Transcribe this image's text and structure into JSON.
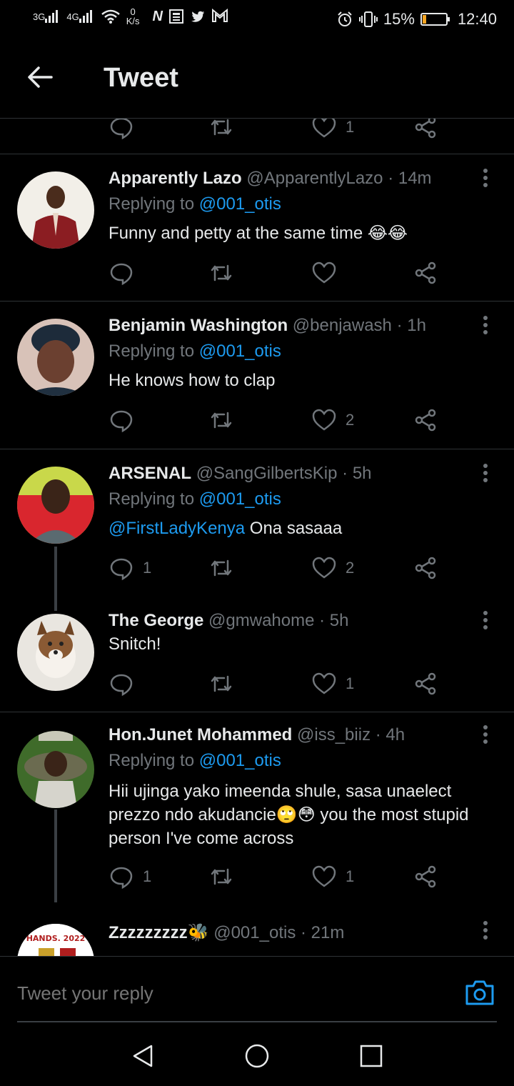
{
  "status_bar": {
    "net1": "3G",
    "net2": "4G",
    "speed_value": "0",
    "speed_unit": "K/s",
    "battery_percent": "15%",
    "battery_level": 0.15,
    "time": "12:40",
    "app_icons": [
      "N",
      "news-icon",
      "twitter-icon",
      "gmail-icon"
    ]
  },
  "header": {
    "title": "Tweet"
  },
  "partial_tweet": {
    "like_count": "1"
  },
  "tweets": [
    {
      "name": "Apparently Lazo",
      "handle": "@ApparentlyLazo",
      "time": "· 14m",
      "replying_prefix": "Replying to",
      "replying_to": "@001_otis",
      "text": "Funny and petty at the same time 😂😂",
      "reply_count": "",
      "like_count": ""
    },
    {
      "name": "Benjamin Washington",
      "handle": "@benjawash",
      "time": "· 1h",
      "replying_prefix": "Replying to",
      "replying_to": "@001_otis",
      "text": "He knows how to clap",
      "reply_count": "",
      "like_count": "2"
    },
    {
      "name": "ARSENAL",
      "handle": "@SangGilbertsKip",
      "time": "· 5h",
      "replying_prefix": "Replying to",
      "replying_to": "@001_otis",
      "mention": "@FirstLadyKenya",
      "text": "Ona sasaaa",
      "reply_count": "1",
      "like_count": "2"
    },
    {
      "name": "The George",
      "handle": "@gmwahome",
      "time": "· 5h",
      "text": "Snitch!",
      "reply_count": "",
      "like_count": "1"
    },
    {
      "name": "Hon.Junet Mohammed",
      "handle": "@iss_biiz",
      "time": "· 4h",
      "replying_prefix": "Replying to",
      "replying_to": "@001_otis",
      "text": "Hii ujinga yako imeenda shule, sasa unaelect prezzo ndo akudancie🙄😳 you the most stupid person I've come across",
      "reply_count": "1",
      "like_count": "1"
    },
    {
      "name": "Zzzzzzzzz🐝",
      "handle": "@001_otis",
      "time": "· 21m",
      "avatar_text": "HANDS. 2022"
    }
  ],
  "reply_bar": {
    "placeholder": "Tweet your reply"
  },
  "colors": {
    "accent": "#1d9bf0",
    "muted": "#71767b",
    "background": "#000000",
    "battery": "#f5a623"
  }
}
